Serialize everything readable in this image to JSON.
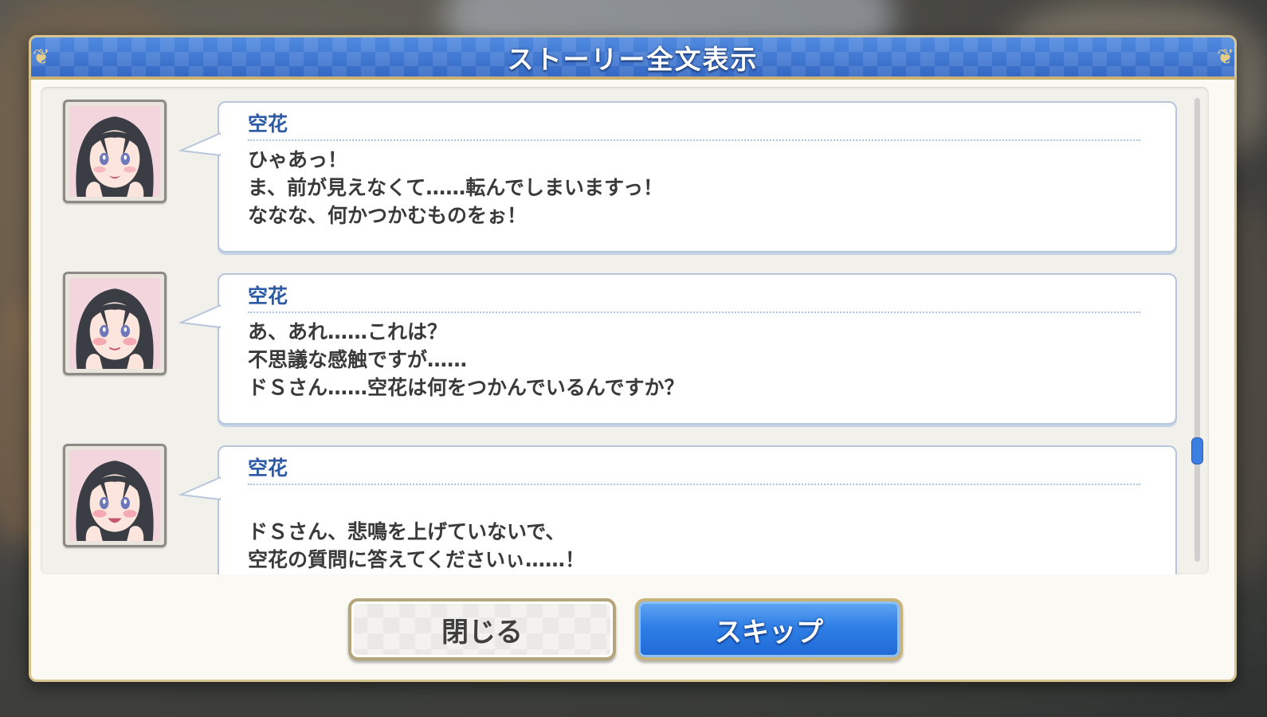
{
  "dialog": {
    "title": "ストーリー全文表示"
  },
  "log": {
    "entries": [
      {
        "speaker": "空花",
        "lines": [
          "ひゃあっ！",
          "ま、前が見えなくて……転んでしまいますっ！",
          "ななな、何かつかむものをぉ！"
        ]
      },
      {
        "speaker": "空花",
        "lines": [
          "あ、あれ……これは？",
          "不思議な感触ですが……",
          "ドＳさん……空花は何をつかんでいるんですか？"
        ]
      },
      {
        "speaker": "空花",
        "lines": [
          "",
          "ドＳさん、悲鳴を上げていないで、",
          "空花の質問に答えてくださいぃ……！"
        ]
      }
    ]
  },
  "buttons": {
    "close_label": "閉じる",
    "skip_label": "スキップ"
  },
  "icons": {
    "avatar": "character-portrait-icon",
    "header_ornament": "gold-corner-ornament-icon"
  },
  "colors": {
    "header_blue": "#3d76cf",
    "speaker_blue": "#2d5aa6",
    "skip_button_blue": "#2f7fe6",
    "frame_gold": "#d8c48f",
    "scroll_thumb": "#3c7fe3"
  }
}
